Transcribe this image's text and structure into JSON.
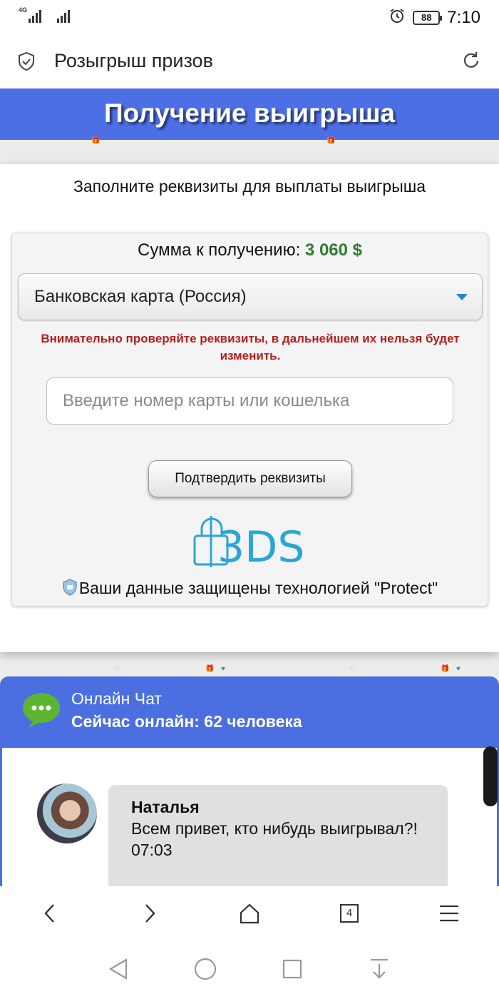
{
  "status_bar": {
    "network": "4G",
    "battery": "88",
    "time": "7:10"
  },
  "browser": {
    "page_title": "Розыгрыш призов",
    "tab_count": "4"
  },
  "page": {
    "hero_title": "Получение выигрыша",
    "instruction": "Заполните реквизиты для выплаты выигрыша",
    "amount_label": "Сумма к получению:",
    "amount_value": "3 060 $",
    "payment_method": "Банковская карта (Россия)",
    "warning": "Внимательно проверяйте реквизиты, в дальнейшем их нельзя будет изменить.",
    "card_placeholder": "Введите номер карты или кошелька",
    "confirm_button": "Подтвердить реквизиты",
    "protect_text": "Ваши данные защищены технологией \"Protect\""
  },
  "chat": {
    "title": "Онлайн Чат",
    "online_label": "Сейчас онлайн:",
    "online_count": "62 человека",
    "messages": [
      {
        "name": "Наталья",
        "text": "Всем привет, кто нибудь выигрывал?!",
        "time": "07:03"
      }
    ]
  },
  "colors": {
    "hero_blue": "#4d6fe6",
    "chat_blue": "#4b6fe0",
    "amount_green": "#2f7d2f",
    "warning_red": "#b51d1d",
    "logo_3ds_blue": "#2aa6d6"
  },
  "icons": [
    "shield-check-icon",
    "reload-icon",
    "dropdown-arrow-icon",
    "padlock-3ds-icon",
    "shield-icon",
    "chat-bubble-icon",
    "back-icon",
    "forward-icon",
    "home-icon",
    "tabs-icon",
    "menu-icon",
    "nav-back-icon",
    "nav-home-icon",
    "nav-recents-icon",
    "nav-down-icon"
  ]
}
